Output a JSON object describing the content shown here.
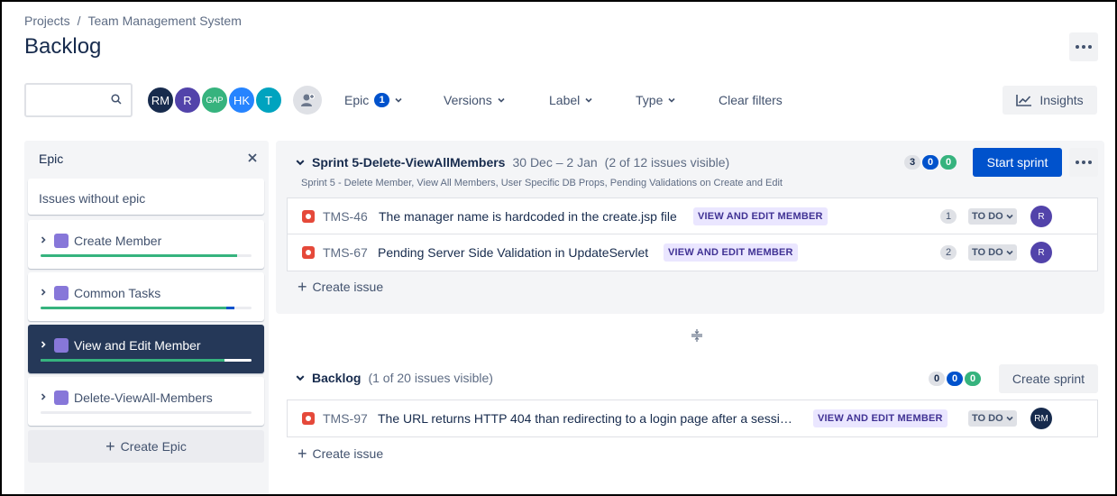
{
  "breadcrumb": {
    "root": "Projects",
    "separator": "/",
    "project": "Team Management System"
  },
  "page": {
    "title": "Backlog"
  },
  "toolbar": {
    "avatars": [
      {
        "initials": "RM",
        "color": "#172b4d"
      },
      {
        "initials": "R",
        "color": "#5243aa"
      },
      {
        "initials": "GAP",
        "color": "#36b37e"
      },
      {
        "initials": "HK",
        "color": "#2684ff"
      },
      {
        "initials": "T",
        "color": "#00a3bf"
      }
    ],
    "filters": {
      "epic": "Epic",
      "epic_count": "1",
      "versions": "Versions",
      "label": "Label",
      "type": "Type",
      "clear": "Clear filters"
    },
    "insights": "Insights"
  },
  "epic_panel": {
    "title": "Epic",
    "no_epic": "Issues without epic",
    "epics": [
      {
        "name": "Create Member",
        "progress_done": 0.93,
        "progress_inprogress": 0.0
      },
      {
        "name": "Common Tasks",
        "progress_done": 0.88,
        "progress_inprogress": 0.04
      },
      {
        "name": "View and Edit Member",
        "progress_done": 0.87,
        "progress_inprogress": 0.0
      },
      {
        "name": "Delete-ViewAll-Members",
        "progress_done": 0.0,
        "progress_inprogress": 0.0
      }
    ],
    "create_epic": "Create Epic"
  },
  "sprint": {
    "name": "Sprint 5-Delete-ViewAllMembers",
    "dates": "30 Dec – 2 Jan",
    "visible": "(2 of 12 issues visible)",
    "goal": "Sprint 5 - Delete Member, View All Members, User Specific DB Props, Pending Validations on Create and Edit",
    "counts": {
      "todo": "3",
      "inprogress": "0",
      "done": "0"
    },
    "start_button": "Start sprint",
    "issues": [
      {
        "key": "TMS-46",
        "summary": "The manager name is hardcoded in the create.jsp file",
        "epic": "VIEW AND EDIT MEMBER",
        "estimate": "1",
        "status": "TO DO",
        "assignee": "R"
      },
      {
        "key": "TMS-67",
        "summary": "Pending Server Side Validation in UpdateServlet",
        "epic": "VIEW AND EDIT MEMBER",
        "estimate": "2",
        "status": "TO DO",
        "assignee": "R"
      }
    ],
    "create_issue": "Create issue"
  },
  "backlog": {
    "name": "Backlog",
    "visible": "(1 of 20 issues visible)",
    "counts": {
      "todo": "0",
      "inprogress": "0",
      "done": "0"
    },
    "create_sprint": "Create sprint",
    "issues": [
      {
        "key": "TMS-97",
        "summary": "The URL returns HTTP 404 than redirecting to a login page after a sessi…",
        "epic": "VIEW AND EDIT MEMBER",
        "status": "TO DO",
        "assignee": "RM"
      }
    ],
    "create_issue": "Create issue"
  },
  "colors": {
    "primary": "#0052cc",
    "bug": "#e5493a",
    "epic_purple": "#8777d9",
    "progress_done": "#36b37e",
    "progress_inprogress": "#0052cc"
  }
}
